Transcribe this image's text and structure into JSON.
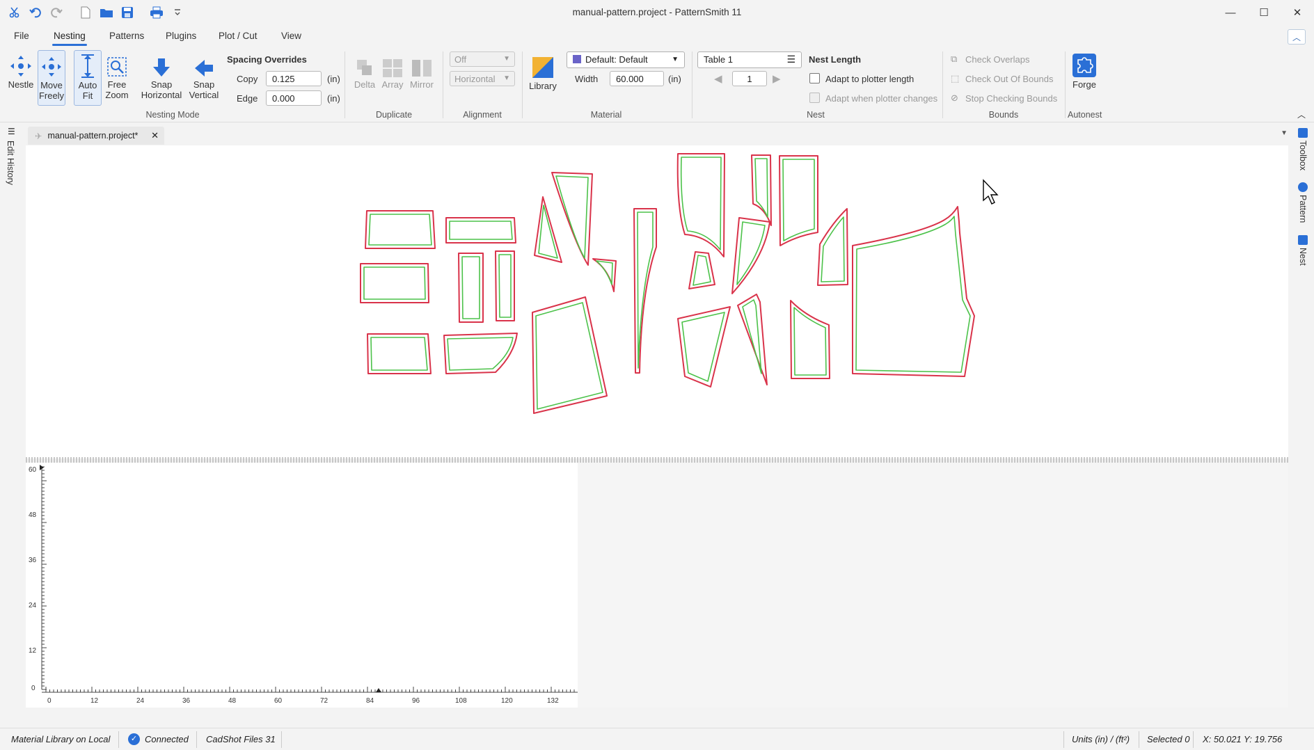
{
  "window": {
    "title": "manual-pattern.project - PatternSmith 11",
    "controls": [
      "minimize-icon",
      "maximize-icon",
      "close-icon"
    ]
  },
  "quick_access": [
    "scissors-icon",
    "undo-icon",
    "redo-icon",
    "new-file-icon",
    "open-folder-icon",
    "save-icon",
    "print-icon",
    "customize-dropdown-icon"
  ],
  "menu": {
    "tabs": [
      "File",
      "Nesting",
      "Patterns",
      "Plugins",
      "Plot / Cut",
      "View"
    ],
    "active": "Nesting"
  },
  "ribbon": {
    "nesting_mode": {
      "label": "Nesting Mode",
      "nestle": "Nestle",
      "move_freely_1": "Move",
      "move_freely_2": "Freely",
      "auto_fit_1": "Auto",
      "auto_fit_2": "Fit",
      "free_zoom_1": "Free",
      "free_zoom_2": "Zoom",
      "snap_h_1": "Snap",
      "snap_h_2": "Horizontal",
      "snap_v_1": "Snap",
      "snap_v_2": "Vertical"
    },
    "spacing": {
      "title": "Spacing Overrides",
      "copy_label": "Copy",
      "copy_value": "0.125",
      "edge_label": "Edge",
      "edge_value": "0.000",
      "unit": "(in)"
    },
    "duplicate": {
      "label": "Duplicate",
      "delta": "Delta",
      "array": "Array",
      "mirror": "Mirror"
    },
    "alignment": {
      "label": "Alignment",
      "first": "Off",
      "second": "Horizontal"
    },
    "material": {
      "label": "Material",
      "library": "Library",
      "selected": "Default: Default",
      "width_label": "Width",
      "width_value": "60.000",
      "unit": "(in)",
      "swatch_color": "#6a63c8"
    },
    "nest": {
      "label": "Nest",
      "table": "Table 1",
      "page": "1",
      "length_title": "Nest Length",
      "adapt_plotter": "Adapt to plotter length",
      "adapt_when": "Adapt when plotter changes"
    },
    "bounds": {
      "label": "Bounds",
      "check_overlaps": "Check Overlaps",
      "check_out": "Check Out Of Bounds",
      "stop_checking": "Stop Checking Bounds"
    },
    "autonest": {
      "label": "Autonest",
      "forge": "Forge"
    }
  },
  "sidebars": {
    "left": "Edit History",
    "right": [
      "Toolbox",
      "Pattern",
      "Nest"
    ]
  },
  "document_tab": "manual-pattern.project*",
  "ruler": {
    "y_ticks": [
      "60",
      "48",
      "36",
      "24",
      "12",
      "0"
    ],
    "x_ticks": [
      "0",
      "12",
      "24",
      "36",
      "48",
      "60",
      "72",
      "84",
      "96",
      "108",
      "120",
      "132"
    ]
  },
  "status": {
    "library": "Material Library on Local",
    "connection": "Connected",
    "cadshot": "CadShot Files 31",
    "units": "Units (in) / (ft²)",
    "selected": "Selected 0",
    "coords": "X: 50.021 Y: 19.756"
  },
  "colors": {
    "accent": "#2a6fd6",
    "piece_outer": "#d9334a",
    "piece_inner": "#4cc24a"
  }
}
